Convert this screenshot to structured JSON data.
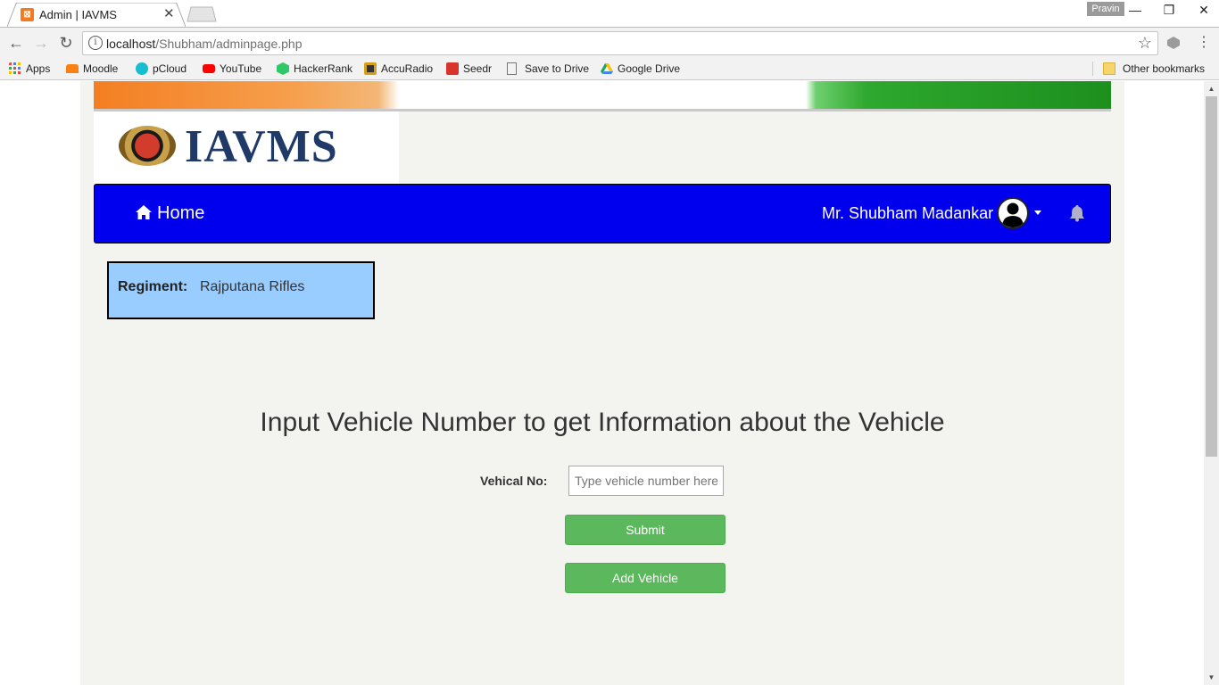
{
  "browser": {
    "tab_title": "Admin | IAVMS",
    "profile_name": "Pravin",
    "url_host": "localhost",
    "url_path": "/Shubham/adminpage.php",
    "bookmarks": [
      {
        "label": "Apps",
        "icon": "apps-grid-icon",
        "color": "#e34b3c"
      },
      {
        "label": "Moodle",
        "icon": "moodle-icon",
        "color": "#f98012"
      },
      {
        "label": "pCloud",
        "icon": "pcloud-icon",
        "color": "#17bed0"
      },
      {
        "label": "YouTube",
        "icon": "youtube-icon",
        "color": "#ff0000"
      },
      {
        "label": "HackerRank",
        "icon": "hackerrank-icon",
        "color": "#2ec866"
      },
      {
        "label": "AccuRadio",
        "icon": "accuradio-icon",
        "color": "#333333"
      },
      {
        "label": "Seedr",
        "icon": "seedr-icon",
        "color": "#d9342b"
      },
      {
        "label": "Save to Drive",
        "icon": "page-icon",
        "color": "#777777"
      },
      {
        "label": "Google Drive",
        "icon": "google-drive-icon",
        "color": "#1fa463"
      }
    ],
    "other_bookmarks": "Other bookmarks"
  },
  "page": {
    "logo_text": "IAVMS",
    "nav": {
      "home_label": "Home",
      "user_name": "Mr. Shubham Madankar"
    },
    "regiment": {
      "label": "Regiment:",
      "value": "Rajputana Rifles"
    },
    "heading": "Input Vehicle Number to get Information about the Vehicle",
    "form": {
      "vehicle_label": "Vehical No:",
      "vehicle_placeholder": "Type vehicle number here",
      "vehicle_value": "",
      "submit_label": "Submit",
      "add_label": "Add Vehicle"
    },
    "colors": {
      "navbar": "#0000ee",
      "regiment_box": "#99ccff",
      "button": "#5cb85c",
      "logo": "#1f3a66"
    }
  }
}
